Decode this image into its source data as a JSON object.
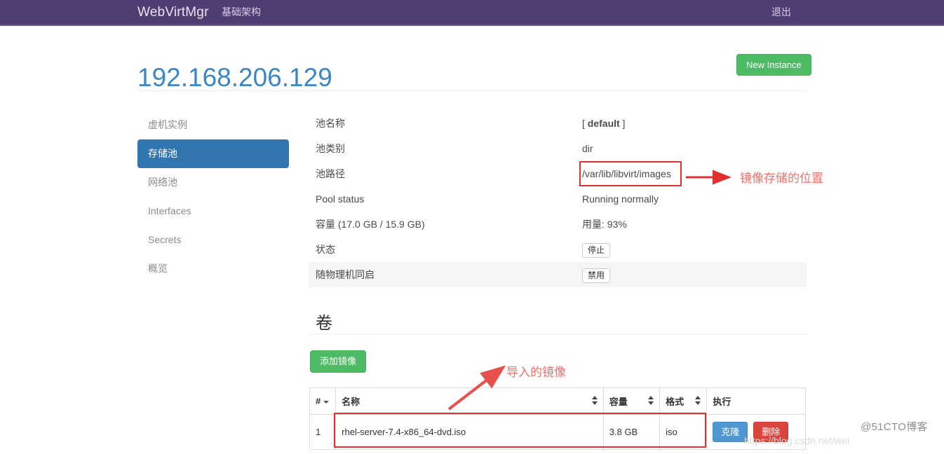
{
  "navbar": {
    "brand": "WebVirtMgr",
    "infrastructure": "基础架构",
    "logout": "退出"
  },
  "header": {
    "title": "192.168.206.129",
    "new_instance_label": "New Instance"
  },
  "sidebar": {
    "items": [
      {
        "label": "虚机实例",
        "active": false
      },
      {
        "label": "存储池",
        "active": true
      },
      {
        "label": "网络池",
        "active": false
      },
      {
        "label": "Interfaces",
        "active": false
      },
      {
        "label": "Secrets",
        "active": false
      },
      {
        "label": "概览",
        "active": false
      }
    ]
  },
  "details": [
    {
      "term": "池名称",
      "term_bold": "",
      "value_prefix": "[ ",
      "value_bold": "default",
      "value_suffix": " ]",
      "value": "",
      "type": "text",
      "striped": false
    },
    {
      "term": "池类别",
      "value": "dir",
      "type": "text",
      "striped": false
    },
    {
      "term": "池路径",
      "value": "/var/lib/libvirt/images",
      "type": "text",
      "striped": false
    },
    {
      "term": "Pool status",
      "value": "Running normally",
      "type": "text",
      "striped": false
    },
    {
      "term": "容量 (17.0 GB / 15.9 GB)",
      "value": "用量: 93%",
      "type": "text",
      "striped": false
    },
    {
      "term": "状态",
      "value": "停止",
      "type": "button",
      "striped": false
    },
    {
      "term": "随物理机同启",
      "value": "禁用",
      "type": "button",
      "striped": true
    }
  ],
  "volumes": {
    "title": "卷",
    "add_image_label": "添加镜像",
    "columns": [
      {
        "label": "#",
        "sort": "caret"
      },
      {
        "label": "名称",
        "sort": "updown"
      },
      {
        "label": "容量",
        "sort": "updown"
      },
      {
        "label": "格式",
        "sort": "updown"
      },
      {
        "label": "执行",
        "sort": "none"
      }
    ],
    "rows": [
      {
        "num": "1",
        "name": "rhel-server-7.4-x86_64-dvd.iso",
        "size": "3.8 GB",
        "format": "iso",
        "clone_label": "克隆",
        "delete_label": "删除"
      }
    ]
  },
  "annotations": [
    {
      "text": "镜像存储的位置"
    },
    {
      "text": "导入的镜像"
    }
  ],
  "watermarks": {
    "main": "@51CTO博客",
    "url": "https://blog.csdn.net/wei"
  },
  "colors": {
    "navbar": "#4f3d73",
    "title": "#3a87c8",
    "accent_green": "#4cbb64",
    "sidebar_active": "#3276b1",
    "annotation_red": "#e03030",
    "annotation_text": "#f2706b",
    "clone_blue": "#5096d0",
    "delete_red": "#d9453c"
  }
}
